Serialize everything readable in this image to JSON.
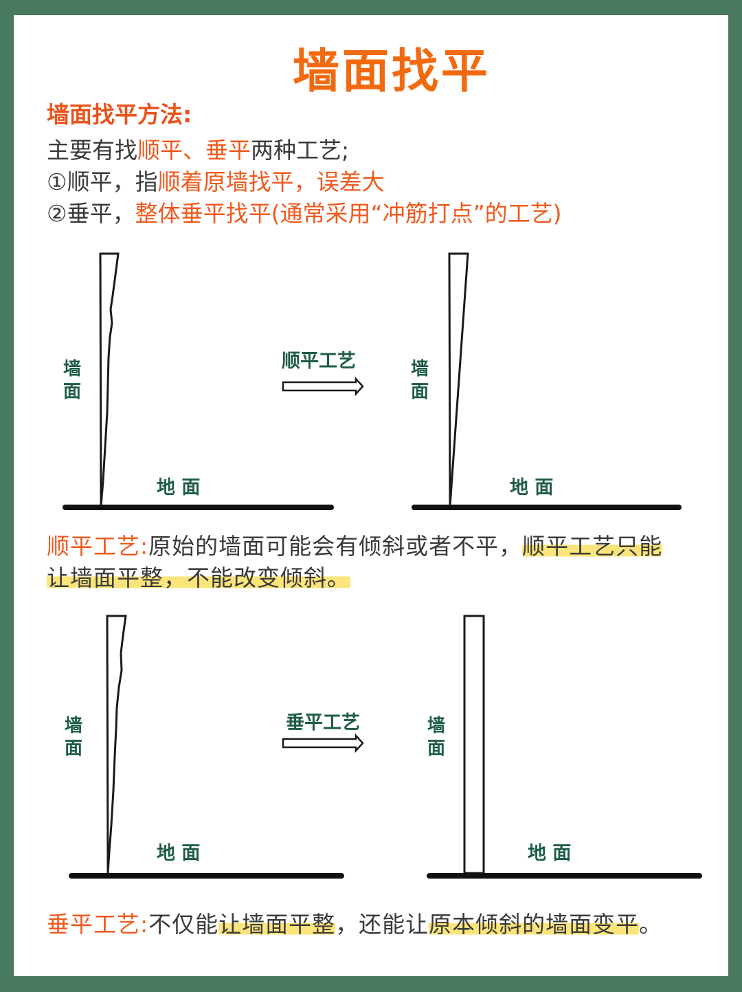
{
  "title": "墙面找平",
  "method_heading": "墙面找平方法:",
  "intro": {
    "prefix": "主要有找",
    "highlight": "顺平、垂平",
    "suffix": "两种工艺;"
  },
  "item1": {
    "prefix": "①顺平，指",
    "highlight": "顺着原墙找平，误差大"
  },
  "item2": {
    "prefix": "②垂平，",
    "highlight": "整体垂平找平(通常采用“冲筋打点”的工艺)"
  },
  "diagram1": {
    "process_label": "顺平工艺",
    "wall_label": "墙面",
    "ground_label": "地 面"
  },
  "diagram2": {
    "process_label": "垂平工艺",
    "wall_label": "墙面",
    "ground_label": "地 面"
  },
  "para1": {
    "term": "顺平工艺:",
    "text1": "原始的墙面可能会有倾斜或者不平，",
    "highlight1": "顺平工艺只能",
    "highlight2": "让墙面平整，不能改变倾斜。"
  },
  "para2": {
    "term": "垂平工艺:",
    "text1": "不仅能",
    "highlight1": "让墙面平整",
    "text2": "，还能让",
    "highlight2": "原本倾斜的墙面变平",
    "text3": "。"
  },
  "colors": {
    "background": "#4a7a5e",
    "accent": "#ee5a1e",
    "label_green": "#1f5c4a",
    "highlight": "#fbe57a"
  }
}
